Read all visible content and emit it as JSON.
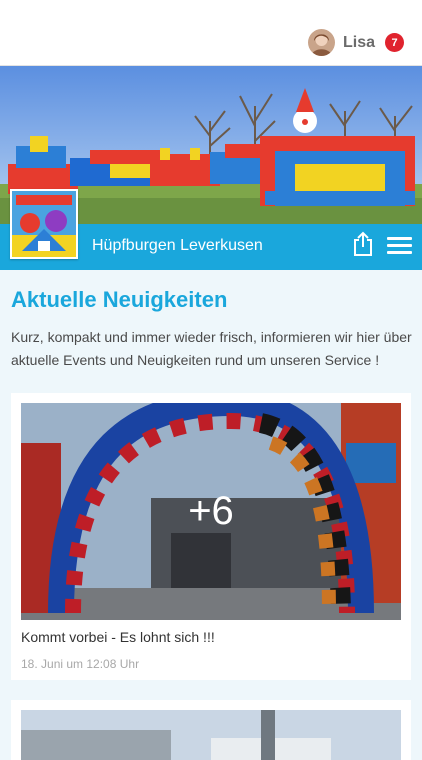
{
  "header": {
    "user_name": "Lisa",
    "notification_count": "7",
    "avatar_icon": "user-avatar-icon"
  },
  "brand": {
    "name": "Hüpfburgen Leverkusen",
    "share_icon": "share-icon",
    "menu_icon": "hamburger-menu-icon"
  },
  "news": {
    "title": "Aktuelle Neuigkeiten",
    "intro": "Kurz, kompakt und immer wieder frisch, informieren wir hier über aktuelle Events und Neuigkeiten rund um unseren Service !",
    "posts": [
      {
        "title": "Kommt vorbei - Es lohnt sich !!!",
        "date": "18. Juni um 12:08 Uhr",
        "more_images": "+6"
      }
    ]
  },
  "colors": {
    "accent": "#1aa7dc",
    "badge": "#e0232e",
    "background": "#eef7fb"
  }
}
